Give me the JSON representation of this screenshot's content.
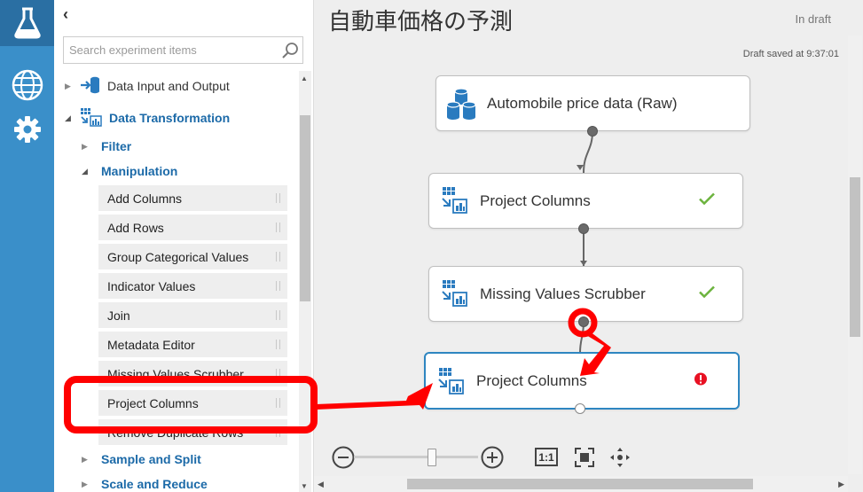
{
  "experiment": {
    "title": "自動車価格の予測",
    "status": "In draft",
    "saved": "Draft saved at 9:37:01"
  },
  "rail": {
    "items": [
      {
        "icon": "flask-icon",
        "active": true
      },
      {
        "icon": "globe-icon",
        "active": false
      },
      {
        "icon": "gear-icon",
        "active": false
      }
    ]
  },
  "palette": {
    "collapse_glyph": "‹",
    "search_placeholder": "Search experiment items",
    "categories": [
      {
        "label": "Data Input and Output",
        "expanded": false
      },
      {
        "label": "Data Transformation",
        "expanded": true
      }
    ],
    "subcategories": [
      {
        "label": "Filter",
        "expanded": false
      },
      {
        "label": "Manipulation",
        "expanded": true
      },
      {
        "label": "Sample and Split",
        "expanded": false
      },
      {
        "label": "Scale and Reduce",
        "expanded": false
      }
    ],
    "items": [
      "Add Columns",
      "Add Rows",
      "Group Categorical Values",
      "Indicator Values",
      "Join",
      "Metadata Editor",
      "Missing Values Scrubber",
      "Project Columns",
      "Remove Duplicate Rows"
    ]
  },
  "canvas": {
    "modules": [
      {
        "label": "Automobile price data (Raw)",
        "icon": "database-icon",
        "status": "none"
      },
      {
        "label": "Project Columns",
        "icon": "project-columns-icon",
        "status": "success"
      },
      {
        "label": "Missing Values Scrubber",
        "icon": "project-columns-icon",
        "status": "success"
      },
      {
        "label": "Project Columns",
        "icon": "project-columns-icon",
        "status": "error"
      }
    ],
    "zoom": {
      "fit_label": "1:1"
    }
  },
  "colors": {
    "rail": "#3a8fc9",
    "rail_active": "#2a6fa3",
    "accent": "#1c6aa8",
    "success": "#6cb33e",
    "error": "#e81123",
    "annotation": "#ff0000",
    "selected_border": "#2e86c1"
  }
}
